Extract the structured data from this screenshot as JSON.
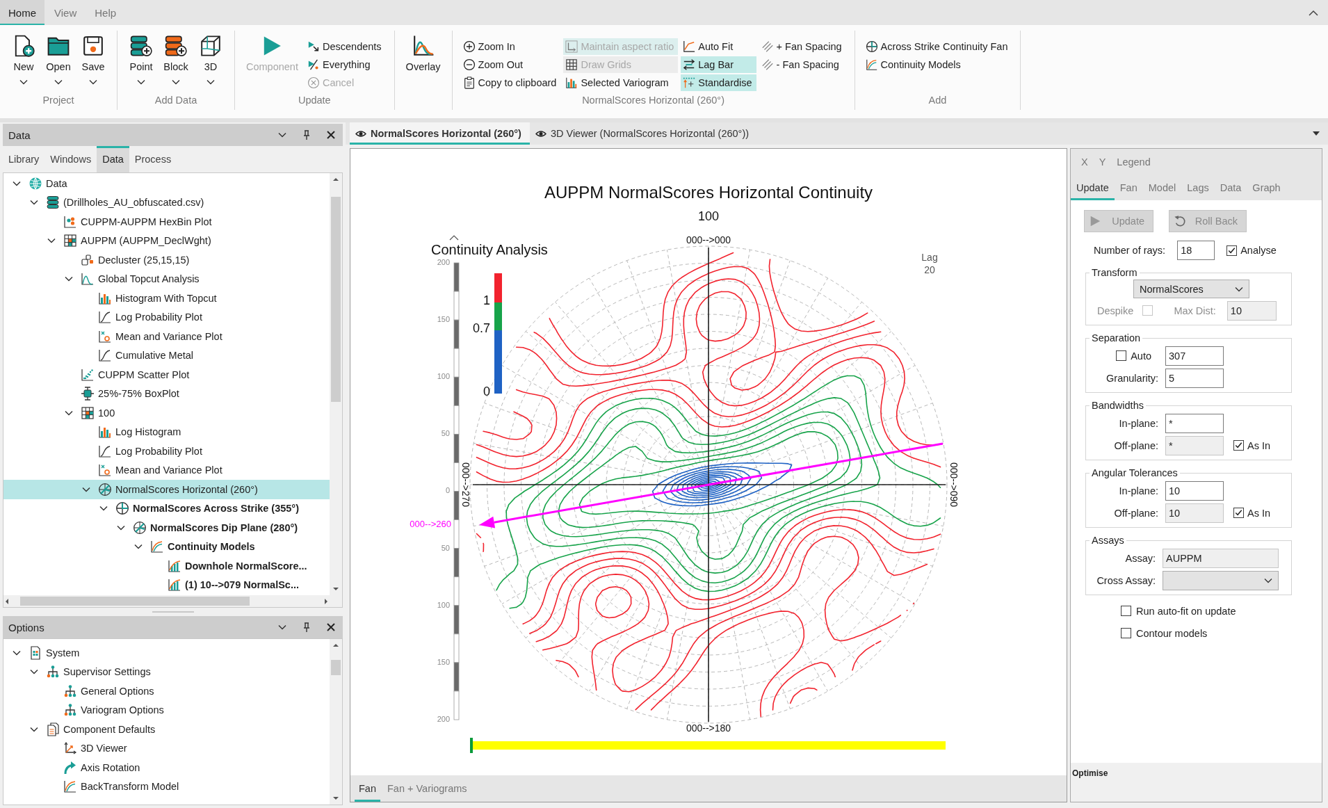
{
  "menu_bar": {
    "tabs": [
      {
        "label": "Home",
        "selected": true
      },
      {
        "label": "View",
        "selected": false
      },
      {
        "label": "Help",
        "selected": false
      }
    ]
  },
  "ribbon": {
    "groups": [
      {
        "label": "Project",
        "items": [
          {
            "label": "New",
            "kind": "large",
            "menu": true,
            "disabled": false
          },
          {
            "label": "Open",
            "kind": "large",
            "menu": true,
            "disabled": false
          },
          {
            "label": "Save",
            "kind": "large",
            "menu": true,
            "disabled": false
          }
        ]
      },
      {
        "label": "Add Data",
        "items": [
          {
            "label": "Point",
            "kind": "large",
            "menu": true,
            "disabled": false
          },
          {
            "label": "Block",
            "kind": "large",
            "menu": true,
            "disabled": false
          },
          {
            "label": "3D",
            "kind": "large",
            "menu": true,
            "disabled": false
          }
        ]
      },
      {
        "label": "Update",
        "items": [
          {
            "label": "Component",
            "kind": "large",
            "menu": false,
            "disabled": true
          },
          {
            "label": "Descendents",
            "kind": "small",
            "disabled": false
          },
          {
            "label": "Everything",
            "kind": "small",
            "disabled": false
          },
          {
            "label": "Cancel",
            "kind": "small",
            "disabled": true
          }
        ]
      },
      {
        "items": [
          {
            "label": "Overlay",
            "kind": "large",
            "menu": false,
            "disabled": false
          }
        ]
      },
      {
        "label": "NormalScores Horizontal (260°)",
        "items": [
          {
            "label": "Zoom In",
            "kind": "small",
            "disabled": false
          },
          {
            "label": "Zoom Out",
            "kind": "small",
            "disabled": false
          },
          {
            "label": "Copy to clipboard",
            "kind": "small",
            "disabled": false
          },
          {
            "label": "Maintain aspect ratio",
            "kind": "toggle",
            "on": true,
            "disabled": true
          },
          {
            "label": "Draw Grids",
            "kind": "toggle",
            "on": false,
            "disabled": true
          },
          {
            "label": "Selected Variogram",
            "kind": "small",
            "disabled": false
          },
          {
            "label": "Auto Fit",
            "kind": "small",
            "disabled": false
          },
          {
            "label": "Lag Bar",
            "kind": "toggle",
            "on": true,
            "disabled": false
          },
          {
            "label": "Standardise",
            "kind": "toggle",
            "on": true,
            "disabled": false
          },
          {
            "label": "+ Fan Spacing",
            "kind": "small",
            "disabled": false
          },
          {
            "label": "- Fan Spacing",
            "kind": "small",
            "disabled": false
          }
        ]
      },
      {
        "label": "Add",
        "items": [
          {
            "label": "Across Strike Continuity Fan",
            "kind": "small",
            "disabled": false
          },
          {
            "label": "Continuity Models",
            "kind": "small",
            "disabled": false
          }
        ]
      }
    ]
  },
  "data_panel": {
    "title": "Data",
    "tabs": [
      {
        "label": "Library",
        "selected": false
      },
      {
        "label": "Windows",
        "selected": false
      },
      {
        "label": "Data",
        "selected": true
      },
      {
        "label": "Process",
        "selected": false
      }
    ],
    "tree": [
      {
        "label": "Data",
        "kind": "root",
        "selected": false,
        "bold": false,
        "expanded": true,
        "children": [
          {
            "label": "(Drillholes_AU_obfuscated.csv)",
            "kind": "dataset",
            "selected": false,
            "bold": false,
            "expanded": true,
            "children": [
              {
                "label": "CUPPM-AUPPM HexBin Plot",
                "kind": "hexbin-plot",
                "selected": false,
                "bold": false
              },
              {
                "label": "AUPPM (AUPPM_DeclWght)",
                "kind": "table",
                "selected": false,
                "bold": false,
                "expanded": true,
                "children": [
                  {
                    "label": "Decluster (25,15,15)",
                    "kind": "decluster",
                    "selected": false,
                    "bold": false
                  },
                  {
                    "label": "Global Topcut Analysis",
                    "kind": "topcut",
                    "selected": false,
                    "bold": false,
                    "expanded": true,
                    "children": [
                      {
                        "label": "Histogram With Topcut",
                        "kind": "histogram",
                        "selected": false,
                        "bold": false
                      },
                      {
                        "label": "Log Probability Plot",
                        "kind": "probability-plot",
                        "selected": false,
                        "bold": false
                      },
                      {
                        "label": "Mean and Variance Plot",
                        "kind": "mean-variance-plot",
                        "selected": false,
                        "bold": false
                      },
                      {
                        "label": "Cumulative Metal",
                        "kind": "probability-plot",
                        "selected": false,
                        "bold": false
                      }
                    ]
                  },
                  {
                    "label": "CUPPM Scatter Plot",
                    "kind": "scatter-plot",
                    "selected": false,
                    "bold": false
                  },
                  {
                    "label": "25%-75% BoxPlot",
                    "kind": "boxplot",
                    "selected": false,
                    "bold": false
                  },
                  {
                    "label": "100",
                    "kind": "table",
                    "selected": false,
                    "bold": false,
                    "expanded": true,
                    "children": [
                      {
                        "label": "Log Histogram",
                        "kind": "histogram",
                        "selected": false,
                        "bold": false
                      },
                      {
                        "label": "Log Probability Plot",
                        "kind": "probability-plot",
                        "selected": false,
                        "bold": false
                      },
                      {
                        "label": "Mean and Variance Plot",
                        "kind": "mean-variance-plot",
                        "selected": false,
                        "bold": false
                      },
                      {
                        "label": "NormalScores Horizontal (260°)",
                        "kind": "fan",
                        "selected": true,
                        "bold": false,
                        "expanded": true,
                        "children": [
                          {
                            "label": "NormalScores Across Strike (355°)",
                            "kind": "across-strike",
                            "selected": false,
                            "bold": true,
                            "expanded": true,
                            "children": [
                              {
                                "label": "NormalScores Dip Plane (280°)",
                                "kind": "dip-plane",
                                "selected": false,
                                "bold": true,
                                "expanded": true,
                                "children": [
                                  {
                                    "label": "Continuity Models",
                                    "kind": "models",
                                    "selected": false,
                                    "bold": true,
                                    "expanded": true,
                                    "children": [
                                      {
                                        "label": "Downhole NormalScore...",
                                        "kind": "variogram",
                                        "selected": false,
                                        "bold": true
                                      },
                                      {
                                        "label": "(1) 10-->079 NormalSc...",
                                        "kind": "variogram",
                                        "selected": false,
                                        "bold": true
                                      }
                                    ]
                                  }
                                ]
                              }
                            ]
                          }
                        ]
                      }
                    ]
                  }
                ]
              }
            ]
          }
        ]
      }
    ]
  },
  "options_panel": {
    "title": "Options",
    "tree": [
      {
        "label": "System",
        "kind": "system",
        "selected": false,
        "bold": false,
        "expanded": true,
        "children": [
          {
            "label": "Supervisor Settings",
            "kind": "settings-group",
            "selected": false,
            "bold": false,
            "expanded": true,
            "children": [
              {
                "label": "General Options",
                "kind": "settings",
                "selected": false,
                "bold": false
              },
              {
                "label": "Variogram Options",
                "kind": "settings",
                "selected": false,
                "bold": false
              }
            ]
          },
          {
            "label": "Component Defaults",
            "kind": "defaults",
            "selected": false,
            "bold": false,
            "expanded": true,
            "children": [
              {
                "label": "3D Viewer",
                "kind": "viewer",
                "selected": false,
                "bold": false
              },
              {
                "label": "Axis Rotation",
                "kind": "rotation",
                "selected": false,
                "bold": false
              },
              {
                "label": "BackTransform Model",
                "kind": "transform-model",
                "selected": false,
                "bold": false
              }
            ]
          }
        ]
      }
    ]
  },
  "document_tabs": [
    {
      "label": "NormalScores Horizontal (260°)",
      "selected": true
    },
    {
      "label": "3D Viewer (NormalScores Horizontal (260°))",
      "selected": false
    }
  ],
  "chart": {
    "title": "AUPPM NormalScores Horizontal Continuity",
    "subtitle": "100",
    "panel_title": "Continuity Analysis",
    "lag_label": "Lag",
    "lag_value": "20",
    "legend_labels": [
      "1",
      "0.7",
      "0"
    ],
    "scale_labels": [
      "200",
      "150",
      "100",
      "50",
      "0",
      "50",
      "100",
      "150",
      "200"
    ],
    "direction_labels": {
      "top": "000-->000",
      "right": "000-->090",
      "bottom": "000-->180",
      "left": "000-->270"
    },
    "major_direction_label": "000-->260"
  },
  "view_tabs": [
    {
      "label": "Fan",
      "selected": true
    },
    {
      "label": "Fan + Variograms",
      "selected": false
    }
  ],
  "settings_panel": {
    "view_tabs": [
      {
        "label": "X",
        "selected": false
      },
      {
        "label": "Y",
        "selected": false
      },
      {
        "label": "Legend",
        "selected": false
      }
    ],
    "tabs": [
      {
        "label": "Update",
        "selected": true
      },
      {
        "label": "Fan",
        "selected": false
      },
      {
        "label": "Model",
        "selected": false
      },
      {
        "label": "Lags",
        "selected": false
      },
      {
        "label": "Data",
        "selected": false
      },
      {
        "label": "Graph",
        "selected": false
      }
    ],
    "buttons": [
      {
        "label": "Update",
        "disabled": true
      },
      {
        "label": "Roll Back",
        "disabled": true
      }
    ],
    "rays": {
      "label": "Number of rays:",
      "value": "18"
    },
    "analyse": {
      "label": "Analyse",
      "checked": true
    },
    "transform": {
      "title": "Transform",
      "method": "NormalScores",
      "despike": {
        "label": "Despike",
        "checked": false,
        "disabled": true
      },
      "max_dist": {
        "label": "Max Dist:",
        "value": "10",
        "disabled": true
      }
    },
    "separation": {
      "title": "Separation",
      "auto": {
        "label": "Auto",
        "checked": false
      },
      "value": "307",
      "granularity": {
        "label": "Granularity:",
        "value": "5"
      }
    },
    "bandwidths": {
      "title": "Bandwidths",
      "in_plane": {
        "label": "In-plane:",
        "value": "*",
        "disabled": false
      },
      "off_plane": {
        "label": "Off-plane:",
        "value": "*",
        "disabled": true
      },
      "as_in": {
        "label": "As In",
        "checked": true
      }
    },
    "angular_tolerances": {
      "title": "Angular Tolerances",
      "in_plane": {
        "label": "In-plane:",
        "value": "10",
        "disabled": false
      },
      "off_plane": {
        "label": "Off-plane:",
        "value": "10",
        "disabled": true
      },
      "as_in": {
        "label": "As In",
        "checked": true
      }
    },
    "assays": {
      "title": "Assays",
      "assay": {
        "label": "Assay:",
        "value": "AUPPM",
        "disabled": true
      },
      "cross_assay": {
        "label": "Cross Assay:"
      }
    },
    "options": [
      {
        "label": "Run auto-fit on update",
        "checked": false
      },
      {
        "label": "Contour models",
        "checked": false
      }
    ],
    "footer": "Optimise"
  }
}
